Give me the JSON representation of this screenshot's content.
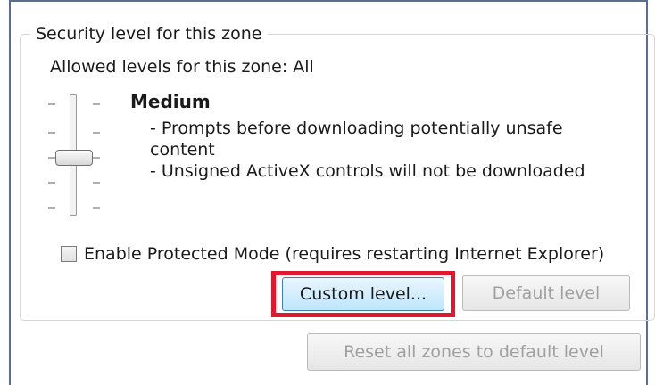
{
  "security_group": {
    "legend": "Security level for this zone",
    "allowed_levels": "Allowed levels for this zone: All",
    "level": {
      "title": "Medium",
      "descriptions": [
        "- Prompts before downloading potentially unsafe",
        "content",
        "- Unsigned ActiveX controls will not be downloaded"
      ]
    },
    "slider": {
      "levels_total": 5,
      "selected_index": 2
    },
    "protected_mode": {
      "label": "Enable Protected Mode (requires restarting Internet Explorer)",
      "checked": false
    },
    "buttons": {
      "custom_level": "Custom level...",
      "default_level": "Default level"
    }
  },
  "reset_button": "Reset all zones to default level",
  "colors": {
    "highlight": "#e0182d",
    "focus_border": "#3c7fb1"
  }
}
